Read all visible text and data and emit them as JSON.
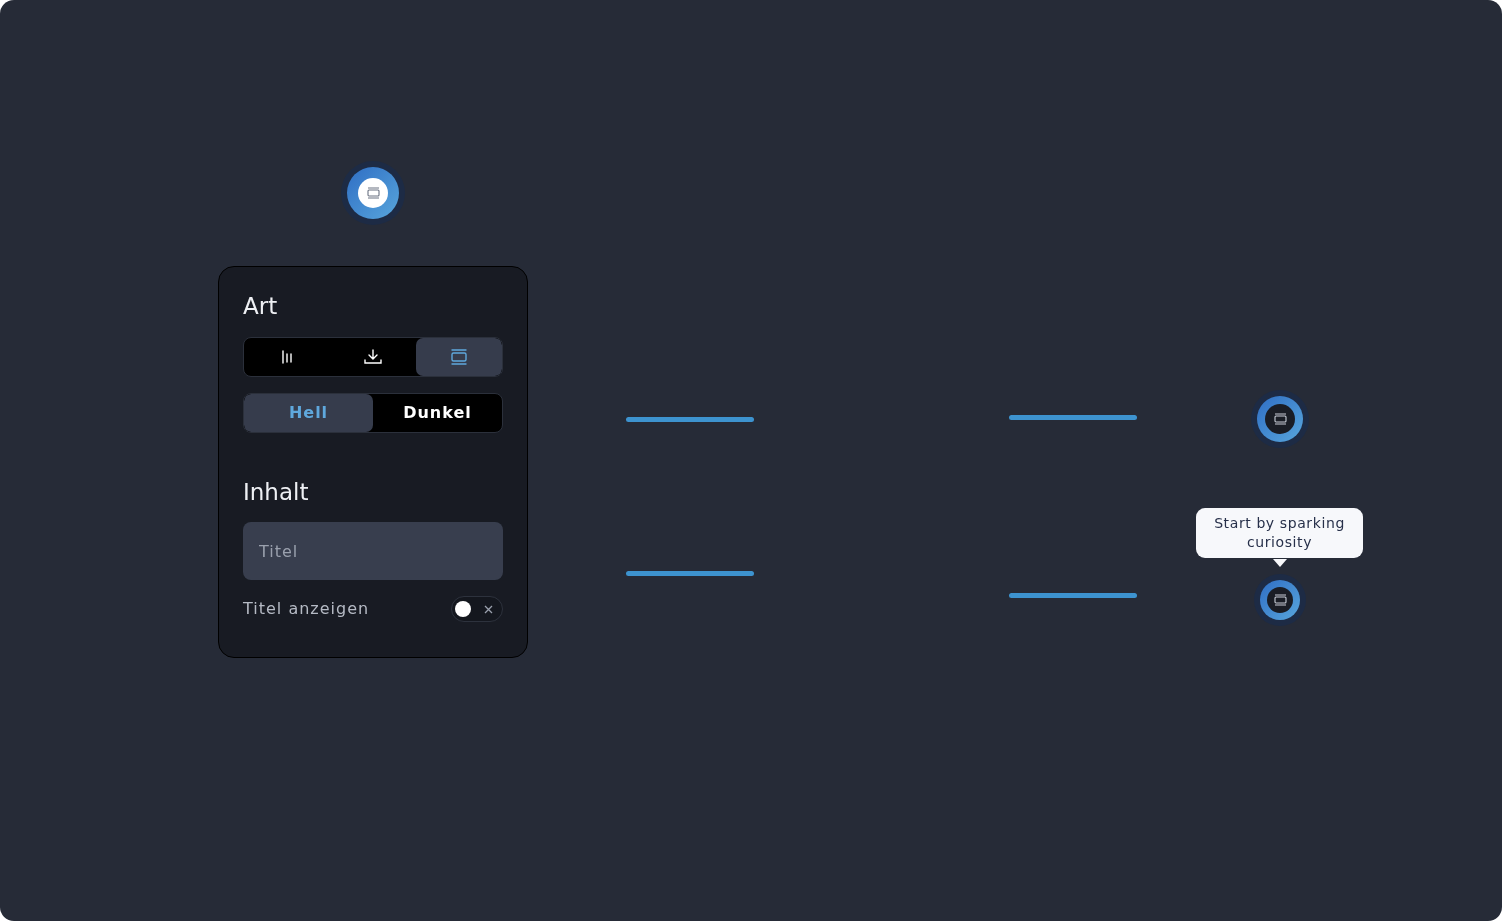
{
  "panel": {
    "sections": [
      {
        "title": "Art"
      },
      {
        "title": "Inhalt"
      }
    ],
    "art_types": [
      {
        "kind": "bars",
        "selected": false
      },
      {
        "kind": "download",
        "selected": false
      },
      {
        "kind": "card",
        "selected": true
      }
    ],
    "theme_options": [
      {
        "label": "Hell",
        "selected": true
      },
      {
        "label": "Dunkel",
        "selected": false
      }
    ],
    "title_field": {
      "placeholder": "Titel"
    },
    "show_title": {
      "label": "Titel anzeigen",
      "on": false
    }
  },
  "markers": [
    {
      "kind": "light"
    },
    {
      "kind": "dark"
    },
    {
      "kind": "dark"
    }
  ],
  "tooltip": {
    "text": "Start by sparking curiosity"
  }
}
